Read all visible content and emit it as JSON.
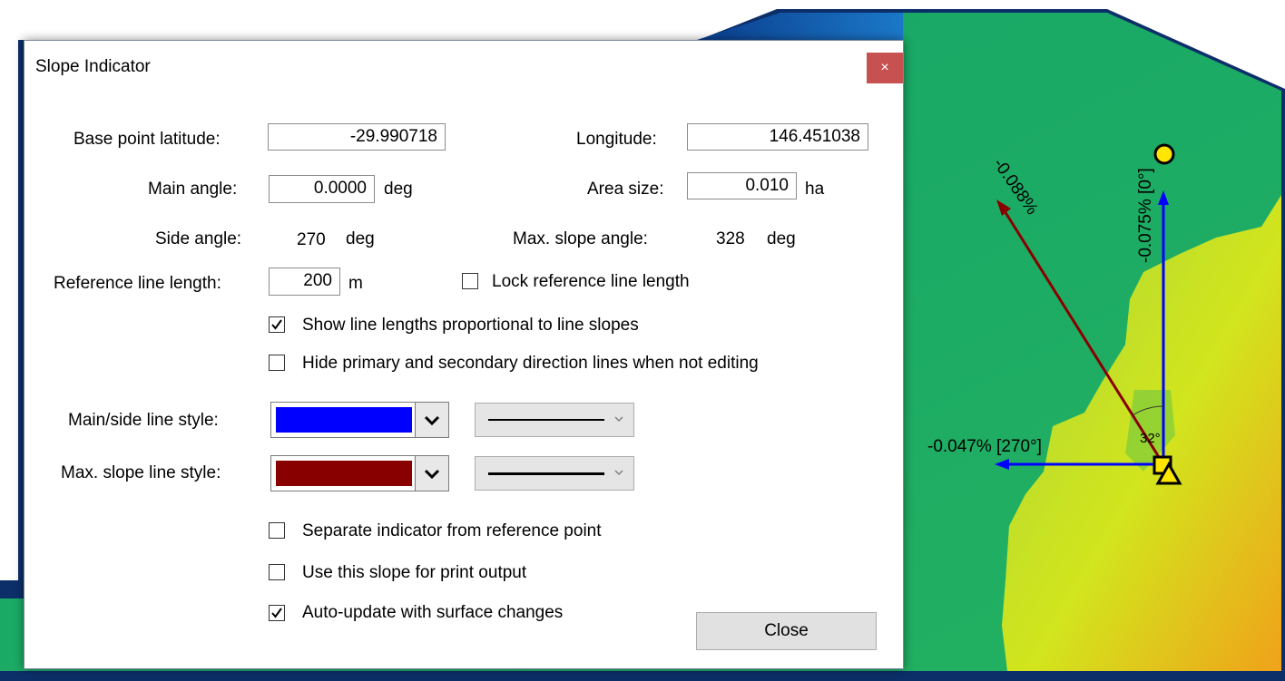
{
  "dialog": {
    "title": "Slope Indicator",
    "close_glyph": "×"
  },
  "form": {
    "base_lat_label": "Base point latitude:",
    "base_lat_value": "-29.990718",
    "longitude_label": "Longitude:",
    "longitude_value": "146.451038",
    "main_angle_label": "Main angle:",
    "main_angle_value": "0.0000",
    "main_angle_unit": "deg",
    "area_size_label": "Area size:",
    "area_size_value": "0.010",
    "area_size_unit": "ha",
    "side_angle_label": "Side angle:",
    "side_angle_value": "270",
    "side_angle_unit": "deg",
    "max_slope_angle_label": "Max. slope angle:",
    "max_slope_angle_value": "328",
    "max_slope_angle_unit": "deg",
    "ref_length_label": "Reference line length:",
    "ref_length_value": "200",
    "ref_length_unit": "m",
    "lock_ref_label": "Lock reference line length",
    "lock_ref_checked": false
  },
  "options": {
    "show_proportional_label": "Show line lengths proportional to line slopes",
    "show_proportional_checked": true,
    "hide_lines_label": "Hide primary and secondary direction lines when not editing",
    "hide_lines_checked": false
  },
  "styles": {
    "main_side_label": "Main/side line style:",
    "main_side_color": "#0000ff",
    "max_slope_label": "Max. slope line style:",
    "max_slope_color": "#880000"
  },
  "bottom_options": {
    "separate_label": "Separate indicator from reference point",
    "separate_checked": false,
    "print_label": "Use this slope for print output",
    "print_checked": false,
    "auto_update_label": "Auto-update with surface changes",
    "auto_update_checked": true
  },
  "buttons": {
    "close_label": "Close"
  },
  "map": {
    "max_slope_text": "-0.088%",
    "main_text": "-0.075% [0°]",
    "side_text": "-0.047% [270°]",
    "angle_text": "32°",
    "main_color": "#0000ff",
    "max_slope_color": "#880000"
  }
}
